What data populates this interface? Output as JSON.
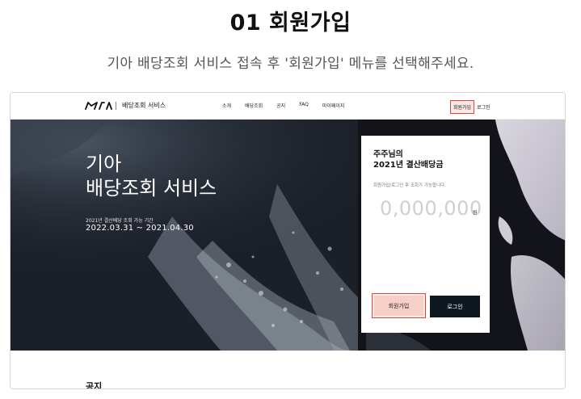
{
  "step": {
    "title": "01 회원가입",
    "description": "기아 배당조회 서비스 접속 후 '회원가입' 메뉴를 선택해주세요."
  },
  "site": {
    "logo": "KIA",
    "service_name": "배당조회 서비스",
    "menu": [
      "소개",
      "배당조회",
      "공지",
      "FAQ",
      "마이페이지"
    ],
    "join_label": "회원가입",
    "login_label": "로그인"
  },
  "hero": {
    "title": "기아\n배당조회 서비스",
    "period_label": "2021년 결산배당 조회 가능 기간",
    "period_dates": "2022.03.31 ~ 2021.04.30"
  },
  "card": {
    "title": "주주님의\n2021년 결산배당금",
    "note": "회원가입/로그인 후 조회가 가능합니다.",
    "amount": "0,000,000",
    "unit": "원",
    "join_button": "회원가입",
    "login_button": "로그인"
  },
  "notice_label": "공지",
  "colors": {
    "highlight_border": "#e0483c",
    "highlight_fill": "#fde9e6",
    "login_button": "#0e1820",
    "hero_dark": "#1c2029"
  }
}
